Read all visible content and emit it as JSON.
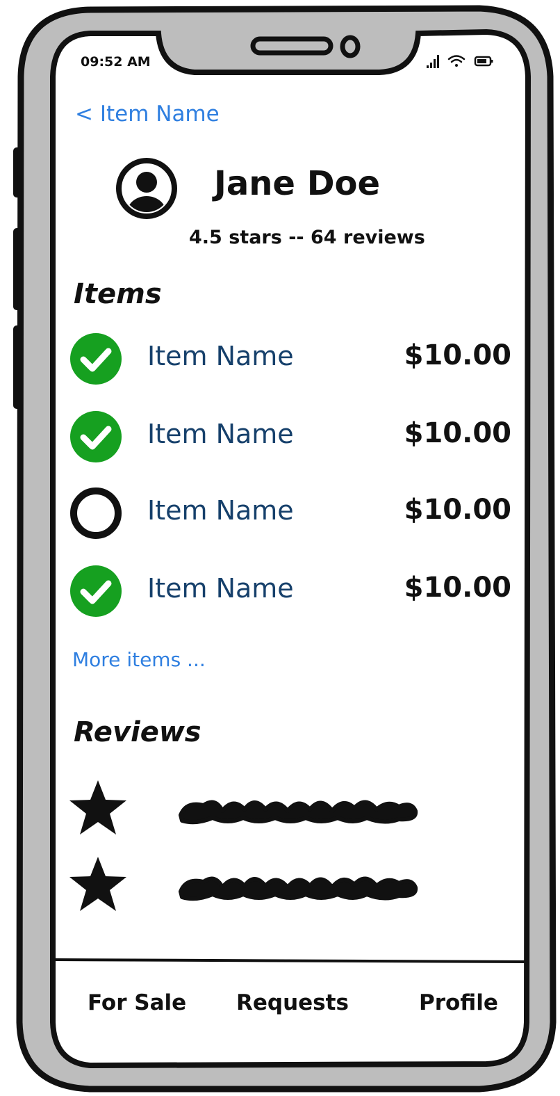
{
  "status_bar": {
    "time": "09:52 AM"
  },
  "nav": {
    "back_label": "< Item Name"
  },
  "profile": {
    "name": "Jane Doe",
    "rating_summary": "4.5 stars -- 64 reviews"
  },
  "items_section": {
    "heading": "Items",
    "items": [
      {
        "name": "Item Name",
        "price": "$10.00",
        "checked": true
      },
      {
        "name": "Item Name",
        "price": "$10.00",
        "checked": true
      },
      {
        "name": "Item Name",
        "price": "$10.00",
        "checked": false
      },
      {
        "name": "Item Name",
        "price": "$10.00",
        "checked": true
      }
    ],
    "more_label": "More items ..."
  },
  "reviews_section": {
    "heading": "Reviews"
  },
  "tab_bar": {
    "tabs": [
      {
        "label": "For Sale"
      },
      {
        "label": "Requests"
      },
      {
        "label": "Profile"
      }
    ]
  },
  "colors": {
    "link_blue": "#2f7fe0",
    "item_name_navy": "#16406b",
    "check_green": "#16a020",
    "device_frame_gray": "#bdbdbd"
  },
  "icons": {
    "back": "chevron-left",
    "avatar": "user-avatar-icon",
    "checked": "check-circle-icon",
    "unchecked": "empty-circle-icon",
    "review": "star-icon"
  }
}
